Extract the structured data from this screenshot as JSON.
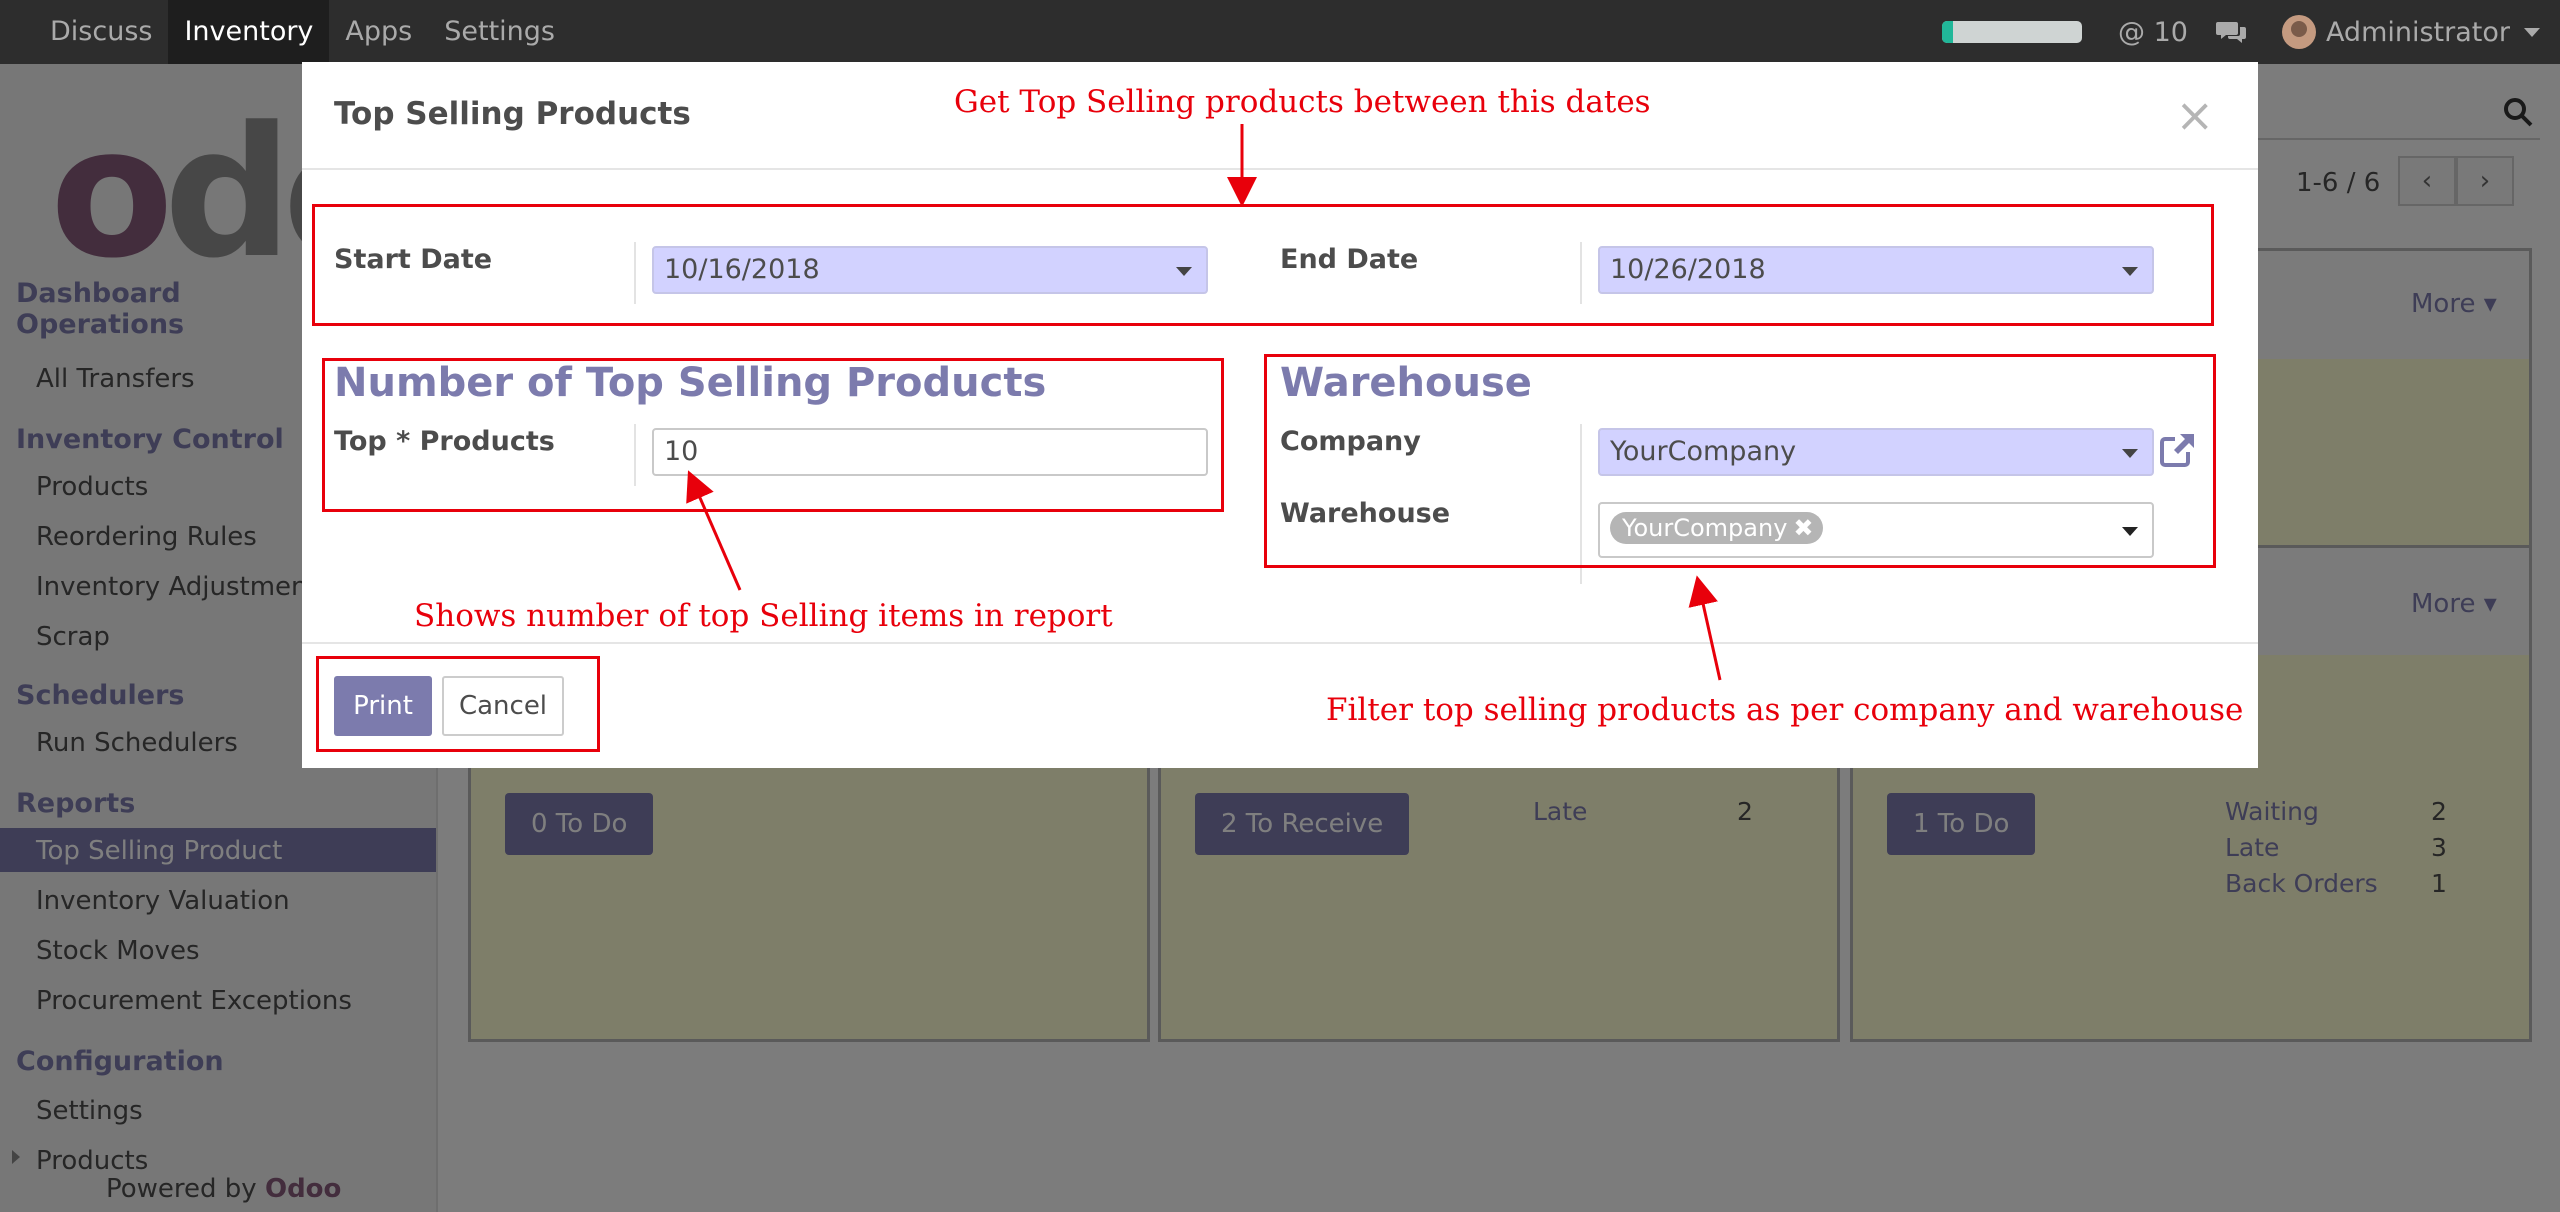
{
  "topbar": {
    "menu": [
      "Discuss",
      "Inventory",
      "Apps",
      "Settings"
    ],
    "active_index": 1,
    "progress_fraction": 0.08,
    "mentions": "@ 10",
    "user": "Administrator",
    "icons": {
      "chat": "chat-bubbles-icon",
      "avatar": "user-avatar"
    }
  },
  "sidebar": {
    "logo_text": "odo",
    "sections": [
      {
        "title": "Dashboard Operations",
        "items": [
          "All Transfers"
        ]
      },
      {
        "title": "Inventory Control",
        "items": [
          "Products",
          "Reordering Rules",
          "Inventory Adjustments",
          "Scrap"
        ]
      },
      {
        "title": "Schedulers",
        "items": [
          "Run Schedulers"
        ]
      },
      {
        "title": "Reports",
        "items": [
          "Top Selling Product",
          "Inventory Valuation",
          "Stock Moves",
          "Procurement Exceptions"
        ]
      },
      {
        "title": "Configuration",
        "items": [
          "Settings",
          "Products"
        ]
      }
    ],
    "section_line1": "Dashboard",
    "section_line2": "Operations",
    "active_item": "Top Selling Product",
    "powered_prefix": "Powered by",
    "powered_brand": "Odoo"
  },
  "control_panel": {
    "pager": "1-6 / 6"
  },
  "cards": {
    "more_label": "More",
    "card1_button": "0 To Do",
    "card2_button": "2 To Receive",
    "card2_stats": [
      {
        "label": "Late",
        "value": "2"
      }
    ],
    "card3_button": "1 To Do",
    "card3_stats": [
      {
        "label": "Waiting",
        "value": "2"
      },
      {
        "label": "Late",
        "value": "3"
      },
      {
        "label": "Back Orders",
        "value": "1"
      }
    ]
  },
  "modal": {
    "title": "Top Selling Products",
    "close": "×",
    "start_date_label": "Start Date",
    "start_date_value": "10/16/2018",
    "end_date_label": "End Date",
    "end_date_value": "10/26/2018",
    "group1_title": "Number of Top Selling Products",
    "top_products_label": "Top * Products",
    "top_products_value": "10",
    "group2_title": "Warehouse",
    "company_label": "Company",
    "company_value": "YourCompany",
    "warehouse_label": "Warehouse",
    "warehouse_tag": "YourCompany",
    "warehouse_tag_remove": "✖",
    "print_label": "Print",
    "cancel_label": "Cancel"
  },
  "annotations": {
    "dates_note": "Get Top Selling products between this dates",
    "count_note": "Shows number of top Selling items in report",
    "filter_note": "Filter top selling products as per company and warehouse",
    "color": "#e8000b"
  },
  "colors": {
    "brand": "#875a7b",
    "accent": "#7c7bad",
    "required_field": "#d2d2ff"
  }
}
